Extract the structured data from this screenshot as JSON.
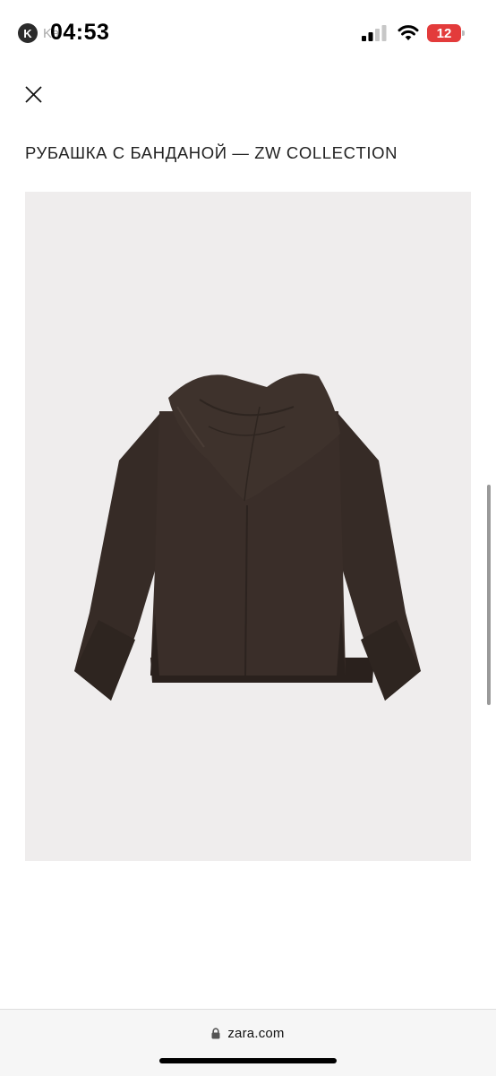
{
  "status_bar": {
    "time": "04:53",
    "back_app_letter": "K",
    "back_app_label": "Ka",
    "battery_level": "12",
    "battery_color": "#e33b3b"
  },
  "header": {
    "close_icon": "close-icon",
    "title": "РУБАШКА С БАНДАНОЙ — ZW COLLECTION"
  },
  "product": {
    "image_icon": "product-photo-brown-shirt-with-bandana",
    "image_background": "#efeded",
    "garment_color": "#3a2e29"
  },
  "browser": {
    "lock_icon": "lock-icon",
    "url": "zara.com"
  }
}
